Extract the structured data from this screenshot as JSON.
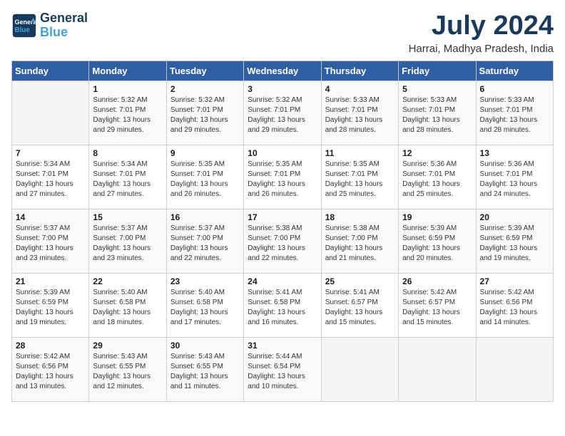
{
  "logo": {
    "line1": "General",
    "line2": "Blue"
  },
  "title": "July 2024",
  "subtitle": "Harrai, Madhya Pradesh, India",
  "headers": [
    "Sunday",
    "Monday",
    "Tuesday",
    "Wednesday",
    "Thursday",
    "Friday",
    "Saturday"
  ],
  "weeks": [
    [
      {
        "day": "",
        "sunrise": "",
        "sunset": "",
        "daylight": ""
      },
      {
        "day": "1",
        "sunrise": "Sunrise: 5:32 AM",
        "sunset": "Sunset: 7:01 PM",
        "daylight": "Daylight: 13 hours and 29 minutes."
      },
      {
        "day": "2",
        "sunrise": "Sunrise: 5:32 AM",
        "sunset": "Sunset: 7:01 PM",
        "daylight": "Daylight: 13 hours and 29 minutes."
      },
      {
        "day": "3",
        "sunrise": "Sunrise: 5:32 AM",
        "sunset": "Sunset: 7:01 PM",
        "daylight": "Daylight: 13 hours and 29 minutes."
      },
      {
        "day": "4",
        "sunrise": "Sunrise: 5:33 AM",
        "sunset": "Sunset: 7:01 PM",
        "daylight": "Daylight: 13 hours and 28 minutes."
      },
      {
        "day": "5",
        "sunrise": "Sunrise: 5:33 AM",
        "sunset": "Sunset: 7:01 PM",
        "daylight": "Daylight: 13 hours and 28 minutes."
      },
      {
        "day": "6",
        "sunrise": "Sunrise: 5:33 AM",
        "sunset": "Sunset: 7:01 PM",
        "daylight": "Daylight: 13 hours and 28 minutes."
      }
    ],
    [
      {
        "day": "7",
        "sunrise": "Sunrise: 5:34 AM",
        "sunset": "Sunset: 7:01 PM",
        "daylight": "Daylight: 13 hours and 27 minutes."
      },
      {
        "day": "8",
        "sunrise": "Sunrise: 5:34 AM",
        "sunset": "Sunset: 7:01 PM",
        "daylight": "Daylight: 13 hours and 27 minutes."
      },
      {
        "day": "9",
        "sunrise": "Sunrise: 5:35 AM",
        "sunset": "Sunset: 7:01 PM",
        "daylight": "Daylight: 13 hours and 26 minutes."
      },
      {
        "day": "10",
        "sunrise": "Sunrise: 5:35 AM",
        "sunset": "Sunset: 7:01 PM",
        "daylight": "Daylight: 13 hours and 26 minutes."
      },
      {
        "day": "11",
        "sunrise": "Sunrise: 5:35 AM",
        "sunset": "Sunset: 7:01 PM",
        "daylight": "Daylight: 13 hours and 25 minutes."
      },
      {
        "day": "12",
        "sunrise": "Sunrise: 5:36 AM",
        "sunset": "Sunset: 7:01 PM",
        "daylight": "Daylight: 13 hours and 25 minutes."
      },
      {
        "day": "13",
        "sunrise": "Sunrise: 5:36 AM",
        "sunset": "Sunset: 7:01 PM",
        "daylight": "Daylight: 13 hours and 24 minutes."
      }
    ],
    [
      {
        "day": "14",
        "sunrise": "Sunrise: 5:37 AM",
        "sunset": "Sunset: 7:00 PM",
        "daylight": "Daylight: 13 hours and 23 minutes."
      },
      {
        "day": "15",
        "sunrise": "Sunrise: 5:37 AM",
        "sunset": "Sunset: 7:00 PM",
        "daylight": "Daylight: 13 hours and 23 minutes."
      },
      {
        "day": "16",
        "sunrise": "Sunrise: 5:37 AM",
        "sunset": "Sunset: 7:00 PM",
        "daylight": "Daylight: 13 hours and 22 minutes."
      },
      {
        "day": "17",
        "sunrise": "Sunrise: 5:38 AM",
        "sunset": "Sunset: 7:00 PM",
        "daylight": "Daylight: 13 hours and 22 minutes."
      },
      {
        "day": "18",
        "sunrise": "Sunrise: 5:38 AM",
        "sunset": "Sunset: 7:00 PM",
        "daylight": "Daylight: 13 hours and 21 minutes."
      },
      {
        "day": "19",
        "sunrise": "Sunrise: 5:39 AM",
        "sunset": "Sunset: 6:59 PM",
        "daylight": "Daylight: 13 hours and 20 minutes."
      },
      {
        "day": "20",
        "sunrise": "Sunrise: 5:39 AM",
        "sunset": "Sunset: 6:59 PM",
        "daylight": "Daylight: 13 hours and 19 minutes."
      }
    ],
    [
      {
        "day": "21",
        "sunrise": "Sunrise: 5:39 AM",
        "sunset": "Sunset: 6:59 PM",
        "daylight": "Daylight: 13 hours and 19 minutes."
      },
      {
        "day": "22",
        "sunrise": "Sunrise: 5:40 AM",
        "sunset": "Sunset: 6:58 PM",
        "daylight": "Daylight: 13 hours and 18 minutes."
      },
      {
        "day": "23",
        "sunrise": "Sunrise: 5:40 AM",
        "sunset": "Sunset: 6:58 PM",
        "daylight": "Daylight: 13 hours and 17 minutes."
      },
      {
        "day": "24",
        "sunrise": "Sunrise: 5:41 AM",
        "sunset": "Sunset: 6:58 PM",
        "daylight": "Daylight: 13 hours and 16 minutes."
      },
      {
        "day": "25",
        "sunrise": "Sunrise: 5:41 AM",
        "sunset": "Sunset: 6:57 PM",
        "daylight": "Daylight: 13 hours and 15 minutes."
      },
      {
        "day": "26",
        "sunrise": "Sunrise: 5:42 AM",
        "sunset": "Sunset: 6:57 PM",
        "daylight": "Daylight: 13 hours and 15 minutes."
      },
      {
        "day": "27",
        "sunrise": "Sunrise: 5:42 AM",
        "sunset": "Sunset: 6:56 PM",
        "daylight": "Daylight: 13 hours and 14 minutes."
      }
    ],
    [
      {
        "day": "28",
        "sunrise": "Sunrise: 5:42 AM",
        "sunset": "Sunset: 6:56 PM",
        "daylight": "Daylight: 13 hours and 13 minutes."
      },
      {
        "day": "29",
        "sunrise": "Sunrise: 5:43 AM",
        "sunset": "Sunset: 6:55 PM",
        "daylight": "Daylight: 13 hours and 12 minutes."
      },
      {
        "day": "30",
        "sunrise": "Sunrise: 5:43 AM",
        "sunset": "Sunset: 6:55 PM",
        "daylight": "Daylight: 13 hours and 11 minutes."
      },
      {
        "day": "31",
        "sunrise": "Sunrise: 5:44 AM",
        "sunset": "Sunset: 6:54 PM",
        "daylight": "Daylight: 13 hours and 10 minutes."
      },
      {
        "day": "",
        "sunrise": "",
        "sunset": "",
        "daylight": ""
      },
      {
        "day": "",
        "sunrise": "",
        "sunset": "",
        "daylight": ""
      },
      {
        "day": "",
        "sunrise": "",
        "sunset": "",
        "daylight": ""
      }
    ]
  ]
}
